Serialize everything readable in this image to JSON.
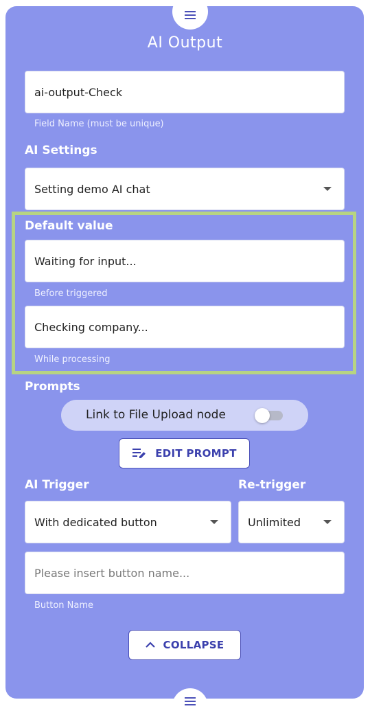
{
  "panel": {
    "title": "AI Output"
  },
  "field_name": {
    "value": "ai-output-Check",
    "helper": "Field Name (must be unique)"
  },
  "ai_settings": {
    "label": "AI Settings",
    "selected": "Setting demo AI chat"
  },
  "default_value": {
    "label": "Default value",
    "before": {
      "value": "Waiting for input...",
      "helper": "Before triggered"
    },
    "while": {
      "value": "Checking company...",
      "helper": "While processing"
    }
  },
  "prompts": {
    "label": "Prompts",
    "toggle_label": "Link to File Upload node",
    "toggle_on": false,
    "edit_button": "EDIT PROMPT"
  },
  "ai_trigger": {
    "label": "AI Trigger",
    "selected": "With dedicated button"
  },
  "re_trigger": {
    "label": "Re-trigger",
    "selected": "Unlimited"
  },
  "button_name": {
    "placeholder": "Please insert button name...",
    "helper": "Button Name"
  },
  "collapse_button": "COLLAPSE",
  "colors": {
    "panel_bg": "#8a94ec",
    "highlight_border": "#b7d482",
    "accent": "#3b40ad"
  },
  "icons": {
    "drag_handle": "menu-lines-icon",
    "edit": "edit-lines-icon",
    "collapse": "chevron-up-icon",
    "dropdown": "caret-down-icon"
  }
}
